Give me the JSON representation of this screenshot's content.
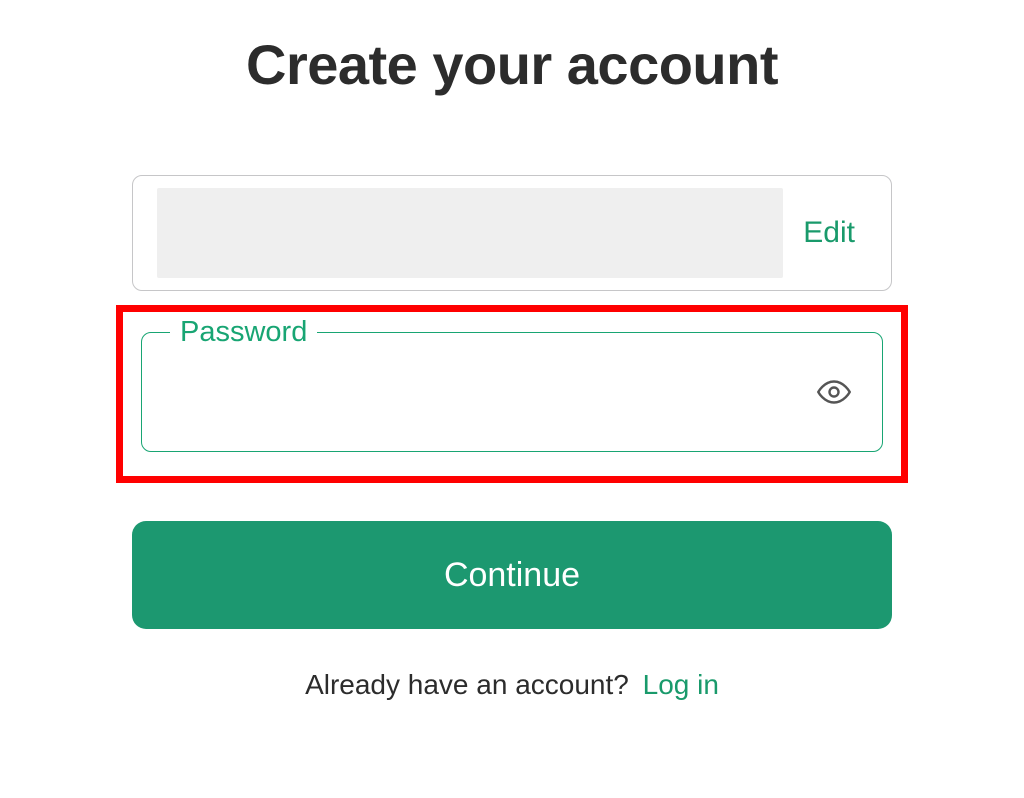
{
  "title": "Create your account",
  "email": {
    "edit_label": "Edit"
  },
  "password": {
    "label": "Password",
    "value": ""
  },
  "continue_label": "Continue",
  "login": {
    "prompt": "Already have an account?",
    "link": "Log in"
  },
  "colors": {
    "accent": "#199a6b",
    "highlight": "#ff0000"
  }
}
